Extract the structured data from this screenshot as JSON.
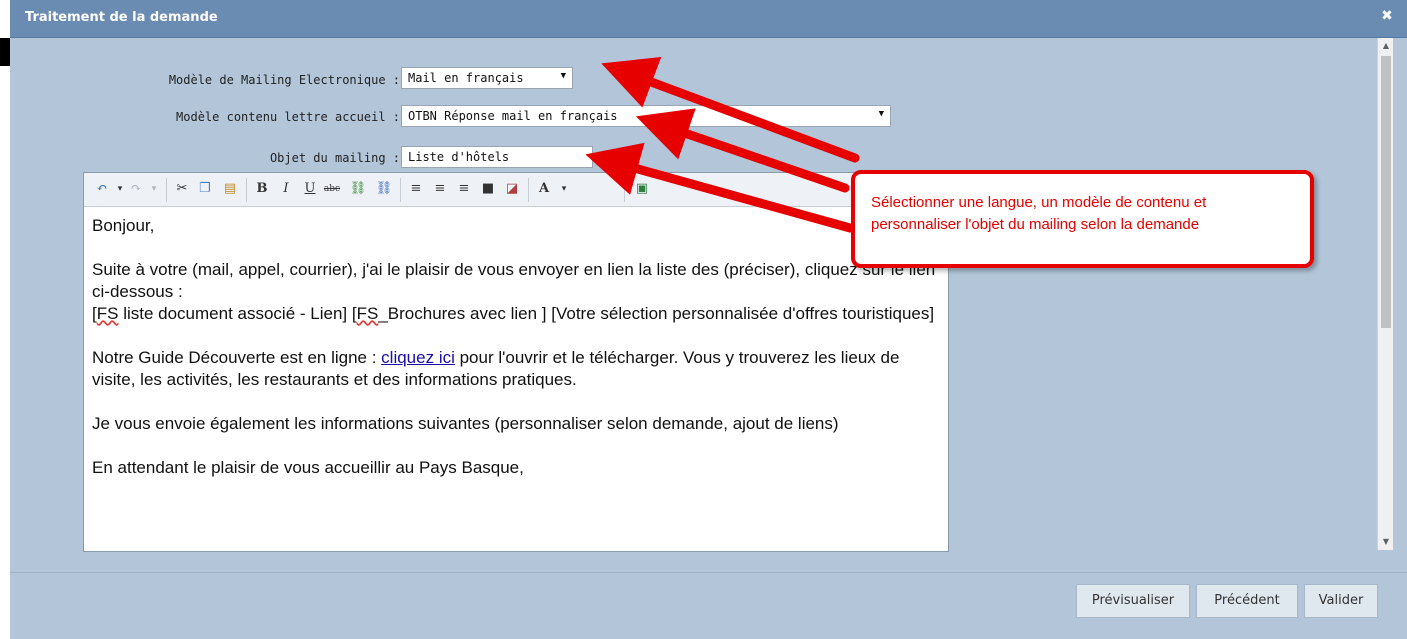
{
  "dialog": {
    "title": "Traitement de la demande",
    "close_label": "✖"
  },
  "form": {
    "mailing_model_label": "Modèle de Mailing Electronique :",
    "mailing_model_value": "Mail en français",
    "content_model_label": "Modèle contenu lettre accueil :",
    "content_model_value": "OTBN Réponse mail en français",
    "subject_label": "Objet du mailing :",
    "subject_value": "Liste d'hôtels"
  },
  "editor": {
    "p1": "Bonjour,",
    "p2_a": "Suite à votre (mail, appel, courrier), j'ai le plaisir de vous envoyer en lien la liste des (préciser), cliquez sur le lien ci-dessous :",
    "p2_b1": "FS",
    "p2_b2": " liste document associé - Lien] [",
    "p2_b3": "FS",
    "p2_b4": "_Brochures avec lien ] [Votre sélection personnalisée d'offres touristiques]",
    "p3_a": "Notre Guide Découverte est en ligne : ",
    "p3_link": "cliquez ici",
    "p3_b": " pour l'ouvrir et le télécharger. Vous y trouverez les lieux de visite, les activités, les restaurants et des informations pratiques.",
    "p4": "Je vous envoie également les informations suivantes (personnaliser selon demande, ajout de liens)",
    "p5": "En attendant le plaisir de vous accueillir au Pays Basque,"
  },
  "callout": {
    "text": "Sélectionner une langue, un modèle de contenu et personnaliser l'objet du mailing selon la demande"
  },
  "footer": {
    "preview": "Prévisualiser",
    "previous": "Précédent",
    "validate": "Valider"
  },
  "icons": [
    "undo-icon",
    "redo-icon",
    "cut-icon",
    "copy-icon",
    "paste-icon",
    "bold-icon",
    "italic-icon",
    "underline-icon",
    "strikethrough-icon",
    "link-icon",
    "unlink-icon",
    "align-left-icon",
    "align-center-icon",
    "align-right-icon",
    "justify-icon",
    "highlight-icon",
    "font-color-icon",
    "image-icon"
  ],
  "colors": {
    "dialog_bg": "#b3c6d9",
    "titlebar": "#6a8cb2",
    "callout_red": "#e60000"
  }
}
